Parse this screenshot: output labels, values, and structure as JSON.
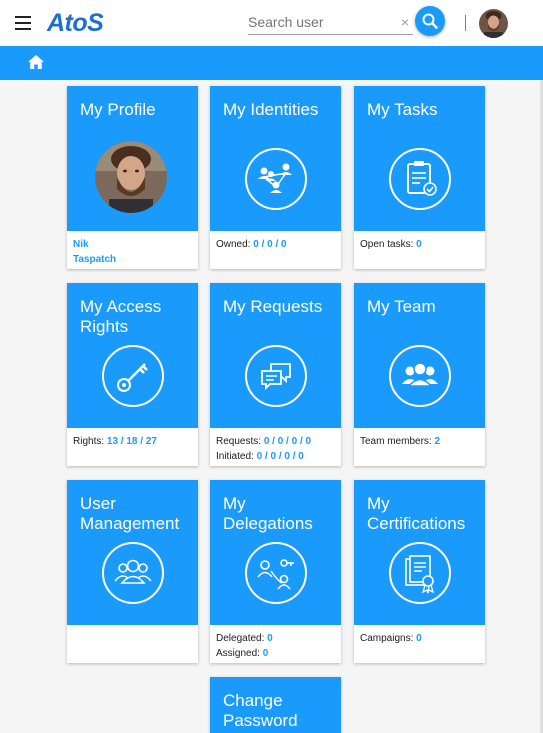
{
  "header": {
    "logo": "AtoS",
    "search_placeholder": "Search user",
    "clear_glyph": "×"
  },
  "tiles": {
    "profile": {
      "title": "My Profile",
      "first_name": "Nik",
      "last_name": "Taspatch"
    },
    "identities": {
      "title": "My Identities",
      "label": "Owned: ",
      "value": "0 / 0 / 0"
    },
    "tasks": {
      "title": "My Tasks",
      "label": "Open tasks: ",
      "value": "0"
    },
    "access_rights": {
      "title": "My Access Rights",
      "label": "Rights: ",
      "value": "13 / 18 / 27"
    },
    "requests": {
      "title": "My Requests",
      "label1": "Requests: ",
      "value1": "0 / 0 / 0 / 0",
      "label2": "Initiated: ",
      "value2": "0 / 0 / 0 / 0"
    },
    "team": {
      "title": "My Team",
      "label": "Team members: ",
      "value": "2"
    },
    "user_management": {
      "title": "User Management"
    },
    "delegations": {
      "title": "My Delegations",
      "label1": "Delegated: ",
      "value1": "0",
      "label2": "Assigned: ",
      "value2": "0"
    },
    "certifications": {
      "title": "My Certifications",
      "label": "Campaigns: ",
      "value": "0"
    },
    "change_password": {
      "title": "Change Password"
    }
  },
  "colors": {
    "brand_blue": "#1a9bfc",
    "logo_blue": "#1f6fd1"
  },
  "icons": [
    "menu-icon",
    "search-icon",
    "home-icon",
    "avatar",
    "identities-icon",
    "clipboard-icon",
    "key-icon",
    "chat-icon",
    "team-icon",
    "users-icon",
    "delegation-icon",
    "certificate-icon"
  ]
}
